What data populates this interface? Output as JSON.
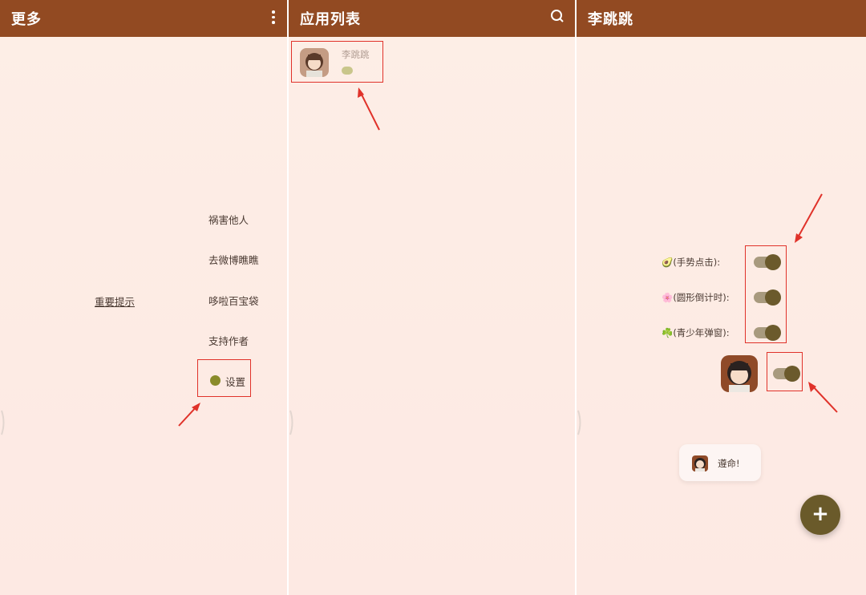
{
  "colors": {
    "topbar": "#924a22",
    "highlight": "#e0322a",
    "fab": "#6a5a2a",
    "switch_knob": "#6b5a2c"
  },
  "panel_more": {
    "title": "更多",
    "overflow_icon": "more-vert-icon",
    "menu": [
      "祸害他人",
      "去微博瞧瞧",
      "哆啦百宝袋",
      "支持作者"
    ],
    "hint_link": "重要提示",
    "settings_label": "设置",
    "settings_icon": "settings-icon"
  },
  "panel_apps": {
    "title": "应用列表",
    "search_icon": "search-icon",
    "app": {
      "name": "李跳跳"
    }
  },
  "panel_detail": {
    "title": "李跳跳",
    "options": [
      "🥑(手势点击):",
      "🌸(圆形倒计时):",
      "☘️(青少年弹窗):"
    ],
    "toast_text": "遵命!",
    "fab_label": "+"
  }
}
